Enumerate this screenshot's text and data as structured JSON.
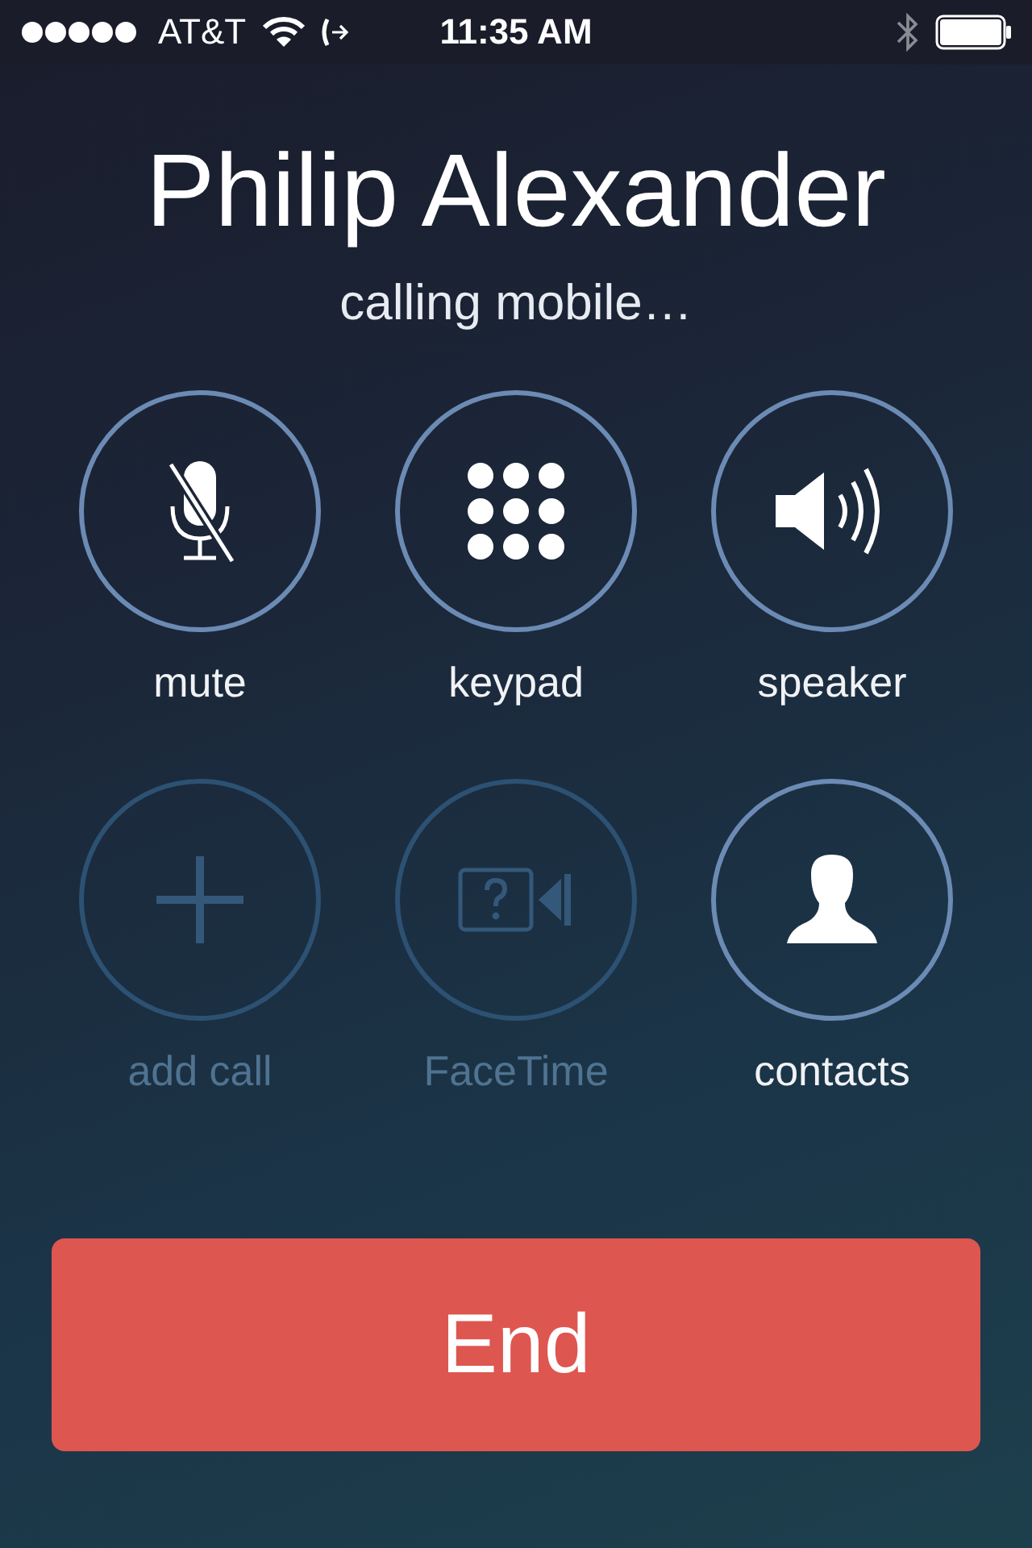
{
  "status_bar": {
    "carrier": "AT&T",
    "time": "11:35 AM"
  },
  "caller": {
    "name": "Philip Alexander",
    "status": "calling mobile…"
  },
  "buttons": [
    {
      "kind": "mute",
      "label": "mute",
      "disabled": false
    },
    {
      "kind": "keypad",
      "label": "keypad",
      "disabled": false
    },
    {
      "kind": "speaker",
      "label": "speaker",
      "disabled": false
    },
    {
      "kind": "add",
      "label": "add call",
      "disabled": true
    },
    {
      "kind": "facetime",
      "label": "FaceTime",
      "disabled": true
    },
    {
      "kind": "contacts",
      "label": "contacts",
      "disabled": false
    }
  ],
  "end_button": {
    "label": "End"
  }
}
